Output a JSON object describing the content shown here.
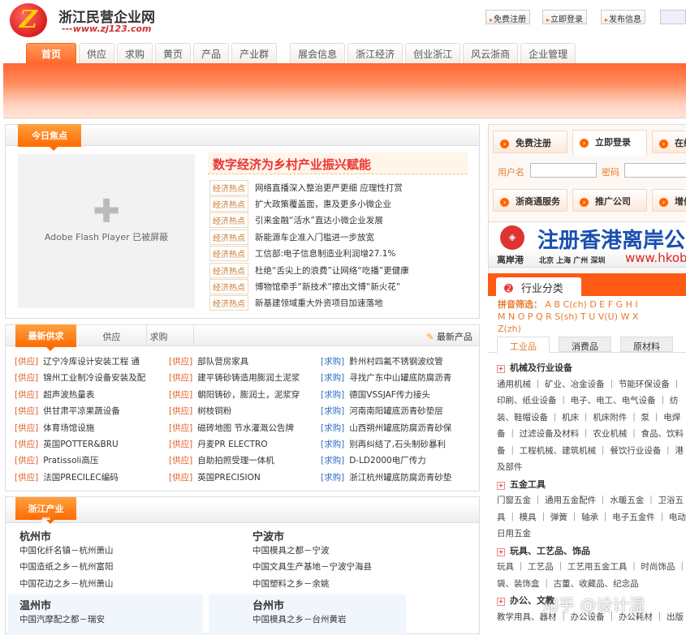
{
  "header": {
    "logo_mark": "Z",
    "site_name": "浙江民营企业网",
    "site_url": "---www.zj123.com",
    "top_buttons": [
      "免费注册",
      "立即登录",
      "发布信息"
    ]
  },
  "nav": {
    "tabs_left": [
      "首页",
      "供应",
      "求购",
      "黄页",
      "产品",
      "产业群"
    ],
    "tabs_right": [
      "展会信息",
      "浙江经济",
      "创业浙江",
      "风云浙商",
      "企业管理"
    ]
  },
  "focus": {
    "title": "今日焦点",
    "flash_text": "Adobe Flash Player 已被屏蔽",
    "headline": "数字经济为乡村产业振兴赋能",
    "tag": "经济热点",
    "news": [
      "网络直播深入整治更严更细 应理性打赏",
      "扩大政策覆盖面，惠及更多小微企业",
      "引来金融“活水”直达小微企业发展",
      "新能源车企准入门槛进一步放宽",
      "工信部:电子信息制造业利润增27.1%",
      "杜绝“舌尖上的浪费”让网络“吃播”更健康",
      "博物馆牵手“新技术”擦出文博“新火花”",
      "新基建领域重大外资项目加速落地"
    ]
  },
  "supply": {
    "title": "最新供求",
    "tabs": [
      "供应",
      "求购"
    ],
    "latest_products": "最新产品",
    "supply_tag": "[供应]",
    "buy_tag": "[求购]",
    "col1": [
      "辽宁冷库设计安装工程 通",
      "锦州工业制冷设备安装及配",
      "超声波热量表",
      "供甘肃平凉果蔬设备",
      "体育场馆设施",
      "英国POTTER&BRU",
      "Pratissoli高压",
      "法国PRECILEC编码"
    ],
    "col2": [
      "部队营房家具",
      "建平铸砂铸造用膨润土泥浆",
      "朝阳铸砂，膨润土，泥浆穿",
      "树枝铜粉",
      "磁砖地图 节水灌溉公告牌",
      "丹麦PR ELECTRO",
      "自助拍照受理一体机",
      "英国PRECISION"
    ],
    "col3": [
      "黔州村四氟不锈钢波纹管",
      "寻找广东中山罐底防腐沥青",
      "德国VSSJAF传力接头",
      "河南南阳罐底沥青砂垫层",
      "山西朔州罐底防腐沥青砂保",
      "别再纠结了,石头制砂暴利",
      "D-LD2000电厂传力",
      "浙江杭州罐底防腐沥青砂垫"
    ]
  },
  "clusters": {
    "title": "浙江产业群",
    "cities": [
      {
        "name": "杭州市",
        "items": [
          "中国化纤名镇－杭州萧山",
          "中国造纸之乡－杭州富阳",
          "中国花边之乡－杭州萧山"
        ]
      },
      {
        "name": "宁波市",
        "items": [
          "中国模具之都－宁波",
          "中国文具生产基地－宁波宁海县",
          "中国塑料之乡－余姚"
        ]
      },
      {
        "name": "温州市",
        "items": [
          "中国汽摩配之都－瑞安"
        ]
      },
      {
        "name": "台州市",
        "items": [
          "中国模具之乡－台州黄岩"
        ]
      }
    ]
  },
  "login": {
    "buttons_top": [
      "免费注册",
      "立即登录",
      "在线"
    ],
    "username_label": "用户名",
    "password_label": "密码",
    "buttons_bottom": [
      "浙商通服务",
      "推广公司",
      "增值"
    ]
  },
  "ad": {
    "brand": "离岸港",
    "headline": "注册香港离岸公",
    "cities": "北京 上海 广州 深圳",
    "url": "www.hkob"
  },
  "categories": {
    "title": "行业分类",
    "pinyin_label": "拼音筛选：",
    "letters_line1": "A B C(ch) D E F G H I",
    "letters_line2": "M N O P Q R S(sh) T U V(U) W X",
    "letters_line3": "Z(zh)",
    "tabs": [
      "工业品",
      "消费品",
      "原材料"
    ],
    "groups": [
      {
        "name": "机械及行业设备",
        "lines": [
          "通用机械 ｜ 矿业、冶金设备 ｜ 节能环保设备 ｜",
          "印刷、纸业设备 ｜ 电子、电工、电气设备 ｜ 纺",
          "装、鞋帽设备 ｜ 机床 ｜ 机床附件 ｜ 泵 ｜ 电焊",
          "备 ｜ 过滤设备及材料 ｜ 农业机械 ｜ 食品、饮料",
          "备 ｜ 工程机械、建筑机械 ｜ 餐饮行业设备 ｜ 港",
          "及部件"
        ]
      },
      {
        "name": "五金工具",
        "lines": [
          "门窗五金 ｜ 通用五金配件 ｜ 水暖五金 ｜ 卫浴五",
          "具 ｜ 模具 ｜ 弹簧 ｜ 轴承 ｜ 电子五金件 ｜ 电动",
          "日用五金"
        ]
      },
      {
        "name": "玩具、工艺品、饰品",
        "lines": [
          "玩具 ｜ 工艺品 ｜ 工艺用五金工具 ｜ 时尚饰品 ｜",
          "袋、装饰盒 ｜ 古董、收藏品、纪念品"
        ]
      },
      {
        "name": "办公、文教",
        "lines": [
          "教学用具、器材 ｜ 办公设备 ｜ 办公耗材 ｜ 出版"
        ]
      }
    ]
  },
  "watermark": "知乎 @设计湿"
}
